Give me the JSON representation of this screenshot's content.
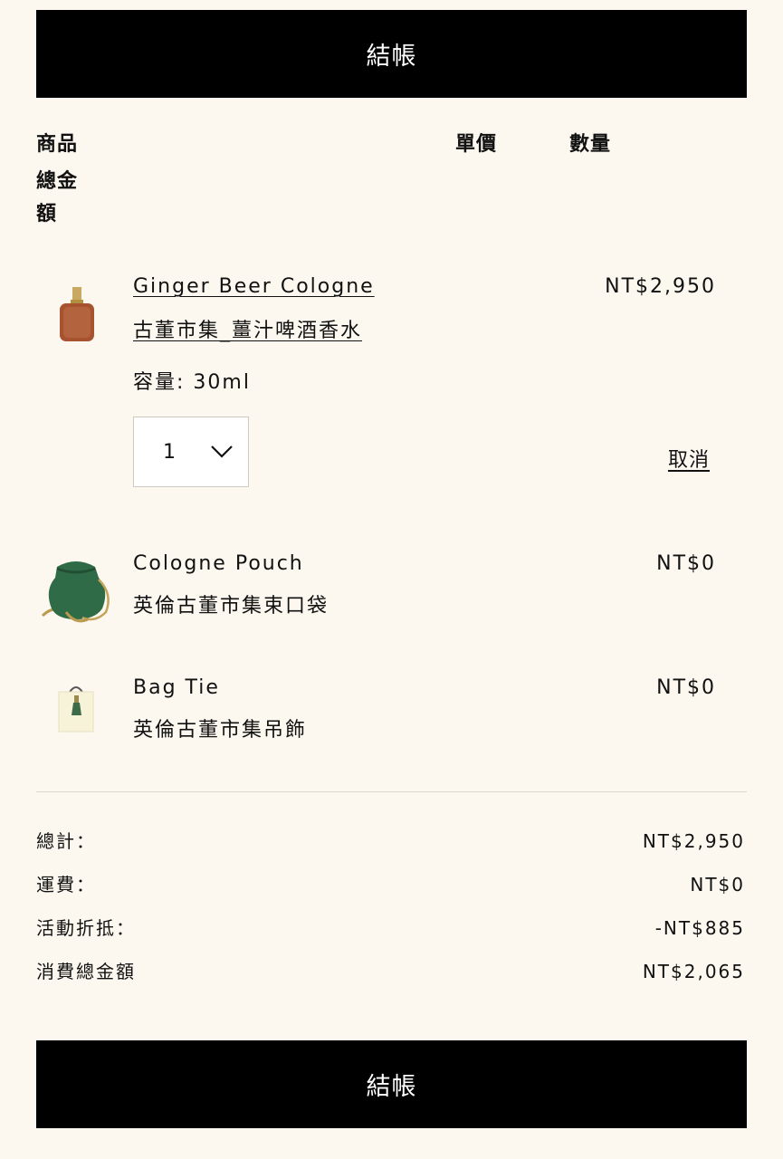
{
  "buttons": {
    "checkout_top": "結帳",
    "checkout_bottom": "結帳"
  },
  "table_headers": {
    "product": "商品",
    "unit_price": "單價",
    "quantity": "數量",
    "total": "總金額"
  },
  "items": [
    {
      "name_en": "Ginger Beer Cologne",
      "name_zh": "古董市集_薑汁啤酒香水",
      "variant": "容量: 30ml",
      "price": "NT$2,950",
      "quantity": "1",
      "remove_label": "取消",
      "thumbnail_icon": "cologne-bottle-icon"
    },
    {
      "name_en": "Cologne Pouch",
      "name_zh": "英倫古董市集束口袋",
      "price": "NT$0",
      "thumbnail_icon": "green-pouch-icon"
    },
    {
      "name_en": "Bag Tie",
      "name_zh": "英倫古董市集吊飾",
      "price": "NT$0",
      "thumbnail_icon": "bag-tag-icon"
    }
  ],
  "summary": {
    "subtotal_label": "總計：",
    "subtotal_value": "NT$2,950",
    "shipping_label": "運費：",
    "shipping_value": "NT$0",
    "discount_label": "活動折抵：",
    "discount_value": "-NT$885",
    "grand_total_label": "消費總金額",
    "grand_total_value": "NT$2,065"
  },
  "colors": {
    "background": "#fcf8ef",
    "button": "#000000",
    "button_text": "#ffffff",
    "text": "#111111"
  }
}
